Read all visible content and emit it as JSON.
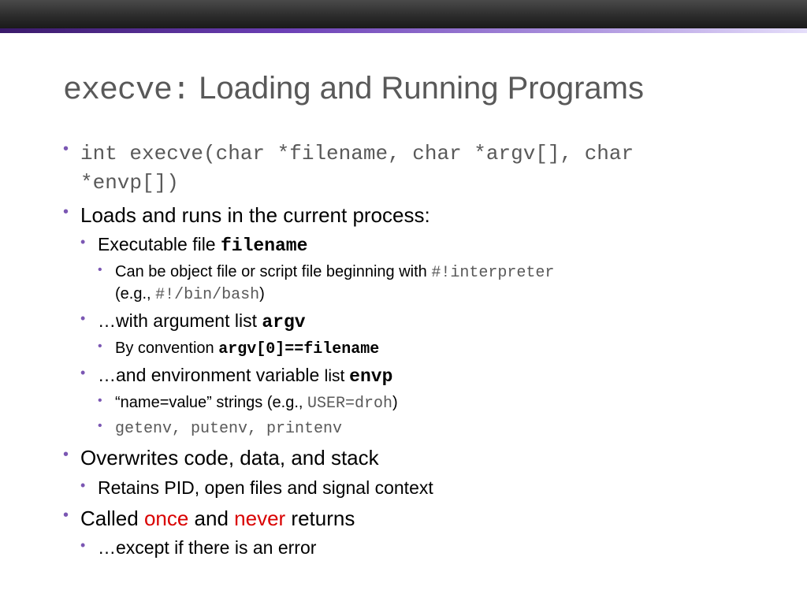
{
  "title_pre": "execve:",
  "title_rest": " Loading and Running Programs",
  "b1_sig": "int execve(char *filename, char *argv[], char *envp[])",
  "b2": "Loads and runs in the current process:",
  "b2a_pre": "Executable  file ",
  "b2a_code": "filename",
  "b2a1_pre": "Can be object file or script file beginning with ",
  "b2a1_code1": "#!interpreter",
  "b2a1_mid": "(e.g., ",
  "b2a1_code2": "#!/bin/bash",
  "b2a1_post": ")",
  "b2b_pre": "…with argument list ",
  "b2b_code": "argv",
  "b2b1_pre": "By convention ",
  "b2b1_code": "argv[0]==filename",
  "b2c_pre": "…and  environment variable ",
  "b2c_mid": "list  ",
  "b2c_code": "envp",
  "b2c1_pre": "“name=value” strings (e.g., ",
  "b2c1_code": "USER=droh",
  "b2c1_post": ")",
  "b2c2": "getenv, putenv, printenv",
  "b3": "Overwrites code, data, and stack",
  "b3a": "Retains PID, open files and signal context",
  "b4_pre": "Called ",
  "b4_red1": "once",
  "b4_mid": " and ",
  "b4_red2": "never",
  "b4_post": " returns",
  "b4a": "…except if there is an error"
}
